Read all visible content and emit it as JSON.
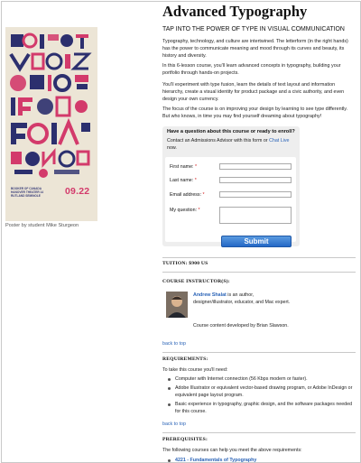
{
  "poster": {
    "small_text": "BOOKER OF CANADA HANOVER THEATER 14 RUTLAND SEMINOLE",
    "date": "09.22",
    "caption": "Poster by student Mike Sturgeon",
    "colors": {
      "background": "#ece5d6",
      "navy": "#2c2f6e",
      "pink": "#d33a6b"
    }
  },
  "course": {
    "title": "Advanced Typography",
    "tagline": "TAP INTO THE POWER OF TYPE IN VISUAL COMMUNICATION",
    "paragraphs": [
      "Typography, technology, and culture are intertwined. The letterform (in the right hands) has the power to communicate meaning and mood through its curves and beauty, its history and diversity.",
      "In this 6-lesson course, you'll learn advanced concepts in typography, building your portfolio through hands-on projects.",
      "You'll experiment with type fusion, learn the details of text layout and information hierarchy, create a visual identity for product package and a civic authority, and even design your own currency.",
      "The focus of the course is on improving your design by learning to see type differently. But who knows, in time you may find yourself dreaming about typography!"
    ]
  },
  "enroll": {
    "question": "Have a question about this course or ready to enroll?",
    "contact_prefix": "Contact an Admissions Advisor with this form or",
    "chat_link": "Chat Live",
    "contact_suffix": "now.",
    "fields": {
      "first_name": "First name:",
      "last_name": "Last name:",
      "email": "Email address:",
      "question": "My question:"
    },
    "required_mark": "*",
    "submit_label": "Submit"
  },
  "tuition": {
    "label": "TUITION: $900 US"
  },
  "instructors": {
    "heading": "COURSE INSTRUCTOR(S):",
    "name": "Andrew Shalat",
    "bio": "is an author, designer/illustrator, educator, and Mac expert.",
    "developed_by": "Course content developed by Brian Slawson."
  },
  "back_to_top": "back to top",
  "requirements": {
    "heading": "REQUIREMENTS:",
    "intro": "To take this course you'll need:",
    "items": [
      "Computer with Internet connection (56 Kbps modem or faster).",
      "Adobe Illustrator or equivalent vector-based drawing program, or Adobe InDesign or equivalent page layout program.",
      "Basic experience in typography, graphic design, and the software packages needed for this course."
    ]
  },
  "prerequisites": {
    "heading": "PREREQUISITES:",
    "intro": "The following courses can help you meet the above requirements:",
    "items": [
      "4221 - Fundamentals of Typography"
    ]
  }
}
